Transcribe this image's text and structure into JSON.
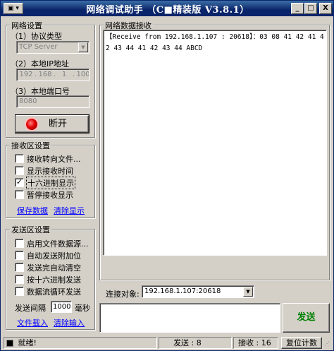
{
  "title": "网络调试助手 （C■精装版 V3.8.1）",
  "title_buttons": [
    "_",
    "□",
    "X"
  ],
  "network": {
    "group_title": "网络设置",
    "protocol_label": "（1）协议类型",
    "protocol_value": "TCP Server",
    "ip_label": "（2）本地IP地址",
    "ip_segments": [
      "192",
      "168",
      "1",
      "100"
    ],
    "port_label": "（3）本地端口号",
    "port_value": "8080",
    "disconnect_label": "断开"
  },
  "receive_settings": {
    "group_title": "接收区设置",
    "options": [
      {
        "label": "接收转向文件...",
        "checked": false
      },
      {
        "label": "显示接收时间",
        "checked": false
      },
      {
        "label": "十六进制显示",
        "checked": true
      },
      {
        "label": "暂停接收显示",
        "checked": false
      }
    ],
    "save_link": "保存数据",
    "clear_link": "清除显示"
  },
  "send_settings": {
    "group_title": "发送区设置",
    "options": [
      {
        "label": "启用文件数据源...",
        "checked": false
      },
      {
        "label": "自动发送附加位",
        "checked": false
      },
      {
        "label": "发送完自动清空",
        "checked": false
      },
      {
        "label": "按十六进制发送",
        "checked": false
      },
      {
        "label": "数据流循环发送",
        "checked": false
      }
    ],
    "interval_label": "发送间隔",
    "interval_value": "1000",
    "interval_unit": "毫秒",
    "load_file_link": "文件载入",
    "clear_input_link": "清除输入"
  },
  "receive_area": {
    "group_title": "网络数据接收",
    "content": "【Receive from 192.168.1.107 : 20618】：03 08 41 42 41 42 43 44 41 42 43 44 ABCD"
  },
  "connection": {
    "label": "连接对象:",
    "value": "192.168.1.107:20618"
  },
  "send_button": "发送",
  "statusbar": {
    "ready": "就绪!",
    "send_count": "发送 : 8",
    "recv_count": "接收 : 16",
    "reset_label": "复位计数"
  },
  "colors": {
    "titlebar": "#0a246a",
    "send_button_text": "#008000",
    "link": "#0000ff",
    "led": "#e00000"
  }
}
